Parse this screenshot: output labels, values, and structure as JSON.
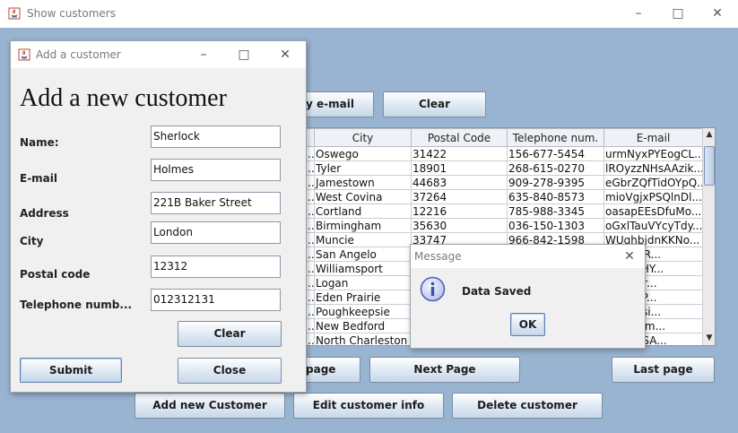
{
  "main_window": {
    "title": "Show customers",
    "search_email_label": "y e-mail",
    "clear_label": "Clear",
    "table": {
      "columns": [
        "City",
        "Postal Code",
        "Telephone num.",
        "E-mail"
      ],
      "rows": [
        [
          "Oswego",
          "31422",
          "156-677-5454",
          "urmNyxPYEogCL..."
        ],
        [
          "Tyler",
          "18901",
          "268-615-0270",
          "lROyzzNHsAAzik..."
        ],
        [
          "Jamestown",
          "44683",
          "909-278-9395",
          "eGbrZQfTidOYpQ..."
        ],
        [
          "West Covina",
          "37264",
          "635-840-8573",
          "mioVgjxPSQlnDl..."
        ],
        [
          "Cortland",
          "12216",
          "785-988-3345",
          "oasapEEsDfuMo..."
        ],
        [
          "Birmingham",
          "35630",
          "036-150-1303",
          "oGxlTauVYcyTdy..."
        ],
        [
          "Muncie",
          "33747",
          "966-842-1598",
          "WUghbjdnKKNo..."
        ],
        [
          "San Angelo",
          "",
          "",
          "KTWCAR..."
        ],
        [
          "Williamsport",
          "",
          "",
          "vaZilIkHY..."
        ],
        [
          "Logan",
          "",
          "",
          "LGblvBr..."
        ],
        [
          "Eden Prairie",
          "",
          "",
          "wOJUHP..."
        ],
        [
          "Poughkeepsie",
          "",
          "",
          "HAOzBsi..."
        ],
        [
          "New Bedford",
          "",
          "",
          "DRbCMm..."
        ],
        [
          "North Charleston",
          "",
          "",
          "XYQXVSA..."
        ]
      ]
    },
    "prev_page_label": "page",
    "next_page_label": "Next Page",
    "last_page_label": "Last page",
    "add_customer_label": "Add new Customer",
    "edit_customer_label": "Edit customer info",
    "delete_customer_label": "Delete customer"
  },
  "dialog": {
    "title": "Add a customer",
    "heading": "Add a new customer",
    "fields": {
      "name_label": "Name:",
      "name_value": "Sherlock",
      "email_label": "E-mail",
      "email_value": "Holmes",
      "address_label": "Address",
      "address_value": "221B Baker Street",
      "city_label": "City",
      "city_value": "London",
      "postal_label": "Postal code",
      "postal_value": "12312",
      "phone_label": "Telephone numb...",
      "phone_value": "012312131"
    },
    "clear_label": "Clear",
    "submit_label": "Submit",
    "close_label": "Close"
  },
  "message_box": {
    "title": "Message",
    "text": "Data Saved",
    "ok_label": "OK"
  },
  "colors": {
    "desktop": "#99b4d1",
    "window_bg": "#f0f0f0",
    "info_icon": "#4a5fb0"
  }
}
